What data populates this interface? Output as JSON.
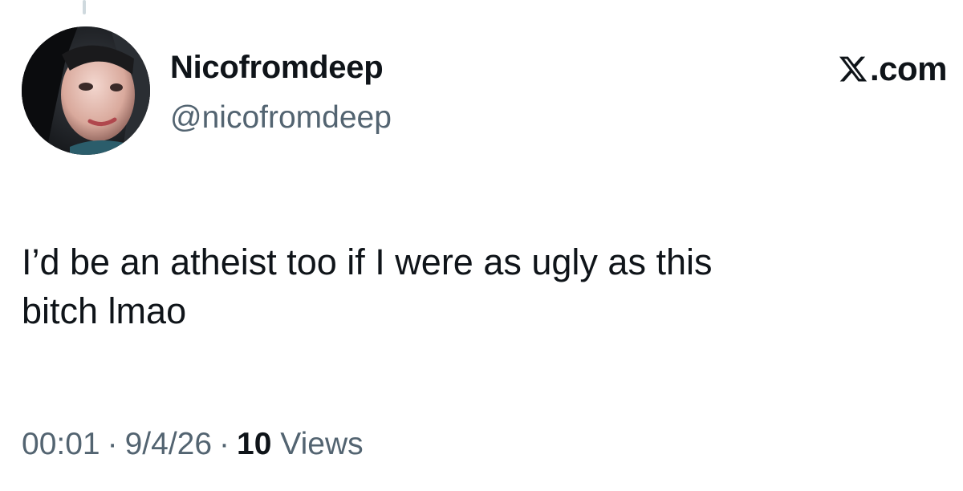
{
  "post": {
    "author": {
      "display_name": "Nicofromdeep",
      "handle": "@nicofromdeep",
      "avatar_icon": "profile-photo"
    },
    "brand": {
      "label": ".com",
      "icon": "x-logo-icon"
    },
    "text_lines": [
      "I’d be an atheist too if I were as ugly as this",
      "bitch lmao"
    ],
    "meta": {
      "time": "00:01",
      "separator": "·",
      "date": "9/4/26",
      "views_count": "10",
      "views_label": "Views"
    }
  },
  "colors": {
    "text_primary": "#0f1419",
    "text_secondary": "#536471",
    "thread_line": "#cfd9de",
    "background": "#ffffff"
  }
}
